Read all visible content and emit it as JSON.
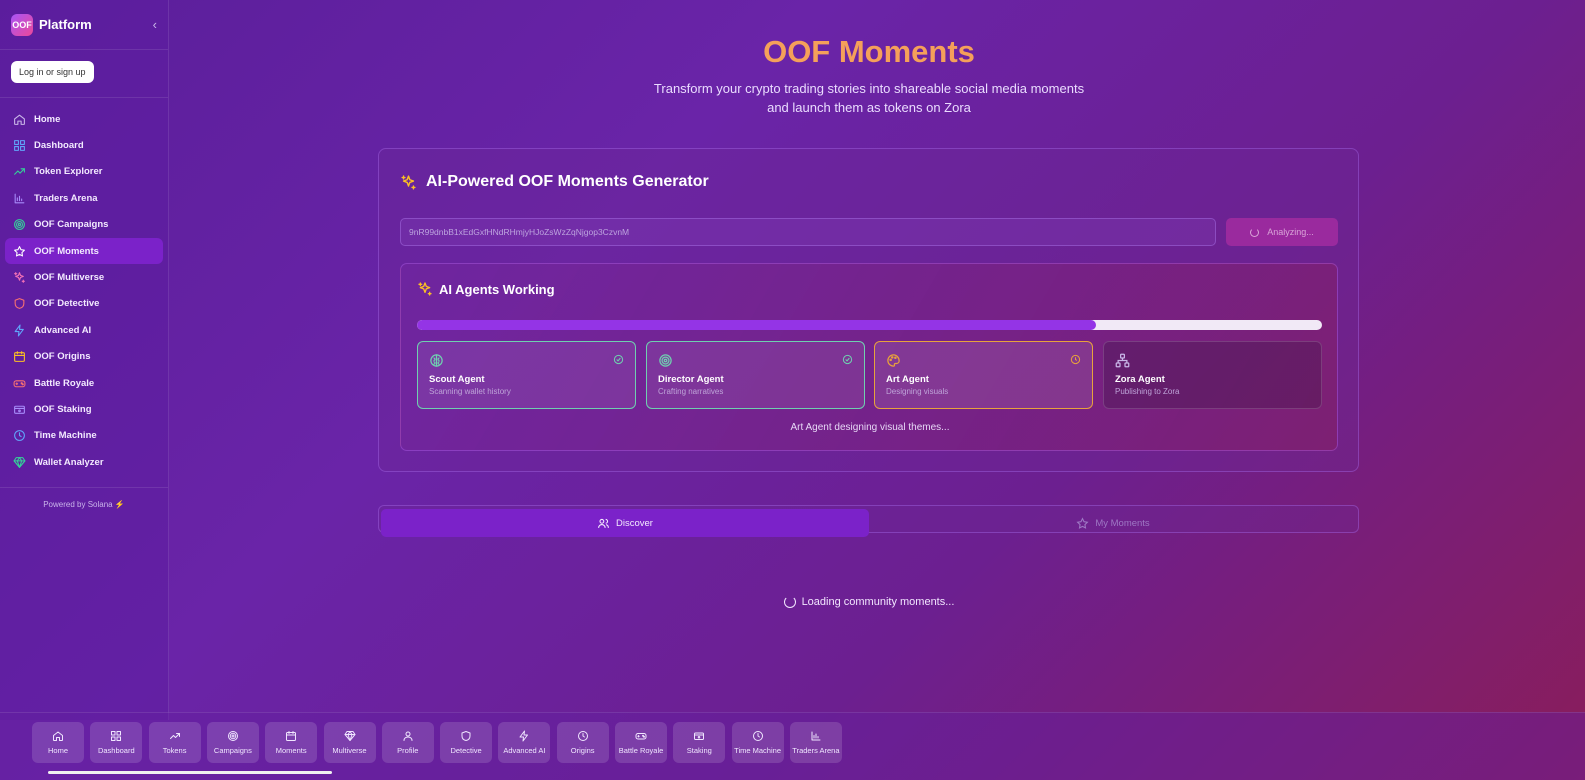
{
  "brand": {
    "logo_text": "OOF",
    "title": "Platform",
    "collapse_icon": "chevron-left-icon"
  },
  "auth": {
    "login_label": "Log in or sign up"
  },
  "sidebar": {
    "items": [
      {
        "label": "Home",
        "icon": "home-icon",
        "color": "#c9b6e8",
        "active": false
      },
      {
        "label": "Dashboard",
        "icon": "dashboard-icon",
        "color": "#60a5fa",
        "active": false
      },
      {
        "label": "Token Explorer",
        "icon": "trending-up-icon",
        "color": "#34d399",
        "active": false
      },
      {
        "label": "Traders Arena",
        "icon": "bar-chart-icon",
        "color": "#a78bfa",
        "active": false
      },
      {
        "label": "OOF Campaigns",
        "icon": "target-icon",
        "color": "#34d399",
        "active": false
      },
      {
        "label": "OOF Moments",
        "icon": "star-icon",
        "color": "#ffffff",
        "active": true
      },
      {
        "label": "OOF Multiverse",
        "icon": "sparkles-icon",
        "color": "#f472b6",
        "active": false
      },
      {
        "label": "OOF Detective",
        "icon": "shield-icon",
        "color": "#f87171",
        "active": false
      },
      {
        "label": "Advanced AI",
        "icon": "zap-icon",
        "color": "#60a5fa",
        "active": false
      },
      {
        "label": "OOF Origins",
        "icon": "calendar-icon",
        "color": "#fbbf24",
        "active": false
      },
      {
        "label": "Battle Royale",
        "icon": "gamepad-icon",
        "color": "#f87171",
        "active": false
      },
      {
        "label": "OOF Staking",
        "icon": "wallet-icon",
        "color": "#a78bfa",
        "active": false
      },
      {
        "label": "Time Machine",
        "icon": "clock-icon",
        "color": "#60a5fa",
        "active": false
      },
      {
        "label": "Wallet Analyzer",
        "icon": "gem-icon",
        "color": "#34d399",
        "active": false
      }
    ],
    "powered_by": "Powered by Solana ⚡"
  },
  "hero": {
    "title": "OOF Moments",
    "subtitle_line1": "Transform your crypto trading stories into shareable social media moments",
    "subtitle_line2": "and launch them as tokens on Zora"
  },
  "generator": {
    "title": "AI-Powered OOF Moments Generator",
    "wallet_address": "9nR99dnbB1xEdGxfHNdRHmjyHJoZsWzZqNjgop3CzvnM",
    "analyze_label": "Analyzing...",
    "agents": {
      "title": "AI Agents Working",
      "progress": 0.75,
      "status_text": "Art Agent designing visual themes...",
      "list": [
        {
          "name": "Scout Agent",
          "desc": "Scanning wallet history",
          "icon": "brain-icon",
          "status": "complete-icon",
          "color": "#6fd0b0"
        },
        {
          "name": "Director Agent",
          "desc": "Crafting narratives",
          "icon": "target-icon",
          "status": "complete-icon",
          "color": "#6fd0b0"
        },
        {
          "name": "Art Agent",
          "desc": "Designing visuals",
          "icon": "palette-icon",
          "status": "in-progress-icon",
          "color": "#e8a23c"
        },
        {
          "name": "Zora Agent",
          "desc": "Publishing to Zora",
          "icon": "network-icon",
          "status": "",
          "color": "#c9b6e8"
        }
      ]
    }
  },
  "tabs": {
    "discover": "Discover",
    "mine": "My Moments"
  },
  "loading_text": "Loading community moments...",
  "bottom_nav": [
    {
      "label": "Home",
      "icon": "home-icon"
    },
    {
      "label": "Dashboard",
      "icon": "dashboard-icon"
    },
    {
      "label": "Tokens",
      "icon": "trending-up-icon"
    },
    {
      "label": "Campaigns",
      "icon": "target-icon"
    },
    {
      "label": "Moments",
      "icon": "calendar-icon"
    },
    {
      "label": "Multiverse",
      "icon": "gem-icon"
    },
    {
      "label": "Profile",
      "icon": "user-icon"
    },
    {
      "label": "Detective",
      "icon": "shield-icon"
    },
    {
      "label": "Advanced AI",
      "icon": "zap-icon"
    },
    {
      "label": "Origins",
      "icon": "clock-icon"
    },
    {
      "label": "Battle Royale",
      "icon": "gamepad-icon"
    },
    {
      "label": "Staking",
      "icon": "wallet-icon"
    },
    {
      "label": "Time Machine",
      "icon": "clock-icon"
    },
    {
      "label": "Traders Arena",
      "icon": "bar-chart-icon"
    }
  ]
}
